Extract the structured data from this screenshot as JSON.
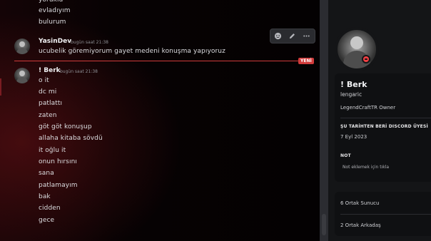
{
  "chat": {
    "top_messages": [
      "yoruklu",
      "evladıyım",
      "bulurum"
    ],
    "messages": [
      {
        "author": "YasinDev",
        "timestamp": "bugün saat 21:38",
        "lines": [
          "ucubelik göremiyorum gayet medeni konuşma yapıyoruz"
        ]
      },
      {
        "author": "! Berk",
        "timestamp": "bugün saat 21:38",
        "lines": [
          "o it",
          "dc mi",
          "patlattı",
          "zaten",
          "göt göt konuşup",
          "allaha kitaba sövdü",
          "it oğlu it",
          "onun hırsını",
          "sana",
          "patlamayım",
          "bak",
          "cidden",
          "gece"
        ]
      }
    ],
    "new_divider_label": "YENİ",
    "toolbar": [
      "add-reaction",
      "edit",
      "more"
    ]
  },
  "profile": {
    "display_name": "! Berk",
    "username": "lengaric",
    "bio": "LegendCraftTR Owner",
    "member_since_label": "ŞU TARİHTEN BERİ DISCORD ÜYESİ",
    "member_since_value": "7 Eyl 2023",
    "note_label": "NOT",
    "note_placeholder": "Not eklemek için tıkla",
    "mutual_servers": "6 Ortak Sunucu",
    "mutual_friends": "2 Ortak Arkadaş",
    "status_color": "#f23f43"
  },
  "colors": {
    "accent_red": "#d13b3b",
    "panel_bg": "#141517",
    "card_bg": "#0f1012"
  }
}
